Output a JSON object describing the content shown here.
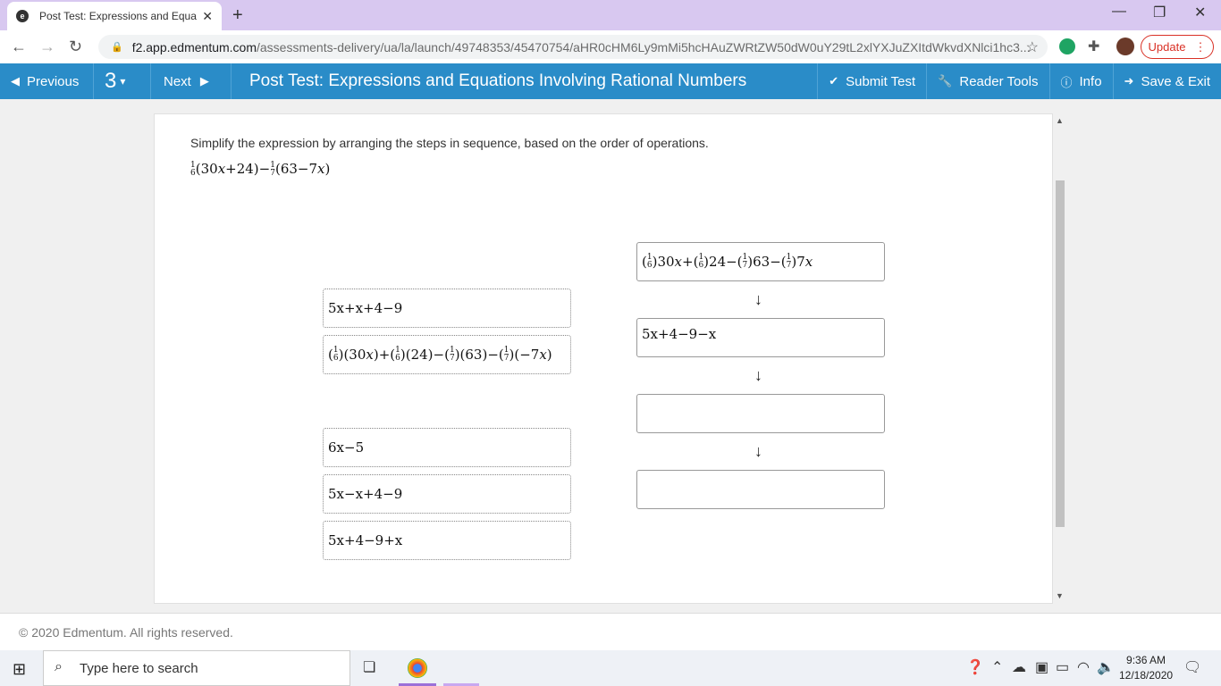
{
  "browser": {
    "tab_title": "Post Test: Expressions and Equati",
    "favicon": "e",
    "url_host": "f2.app.edmentum.com",
    "url_path": "/assessments-delivery/ua/la/launch/49748353/45470754/aHR0cHM6Ly9mMi5hcHAuZWRtZW50dW0uY29tL2xlYXJuZXItdWkvdXNlci1hc3...",
    "update_label": "Update"
  },
  "toolbar": {
    "previous_label": "Previous",
    "question_number": "3",
    "next_label": "Next",
    "title": "Post Test: Expressions and Equations Involving Rational Numbers",
    "submit_label": "Submit Test",
    "reader_tools_label": "Reader Tools",
    "info_label": "Info",
    "save_exit_label": "Save & Exit"
  },
  "question": {
    "instruction": "Simplify the expression by arranging the steps in sequence, based on the order of operations."
  },
  "source_tiles": [
    "5x+x+4−9",
    "6x−5",
    "5x−x+4−9",
    "5x+4−9+x"
  ],
  "target_slots": [
    "",
    "5x+4−9−x",
    "",
    ""
  ],
  "footer": {
    "copyright": "© 2020 Edmentum. All rights reserved."
  },
  "taskbar": {
    "search_placeholder": "Type here to search",
    "time": "9:36 AM",
    "date": "12/18/2020"
  },
  "colors": {
    "toolbar_blue": "#2a8cc8",
    "tab_strip": "#d8c8f0",
    "update_red": "#d93025"
  }
}
